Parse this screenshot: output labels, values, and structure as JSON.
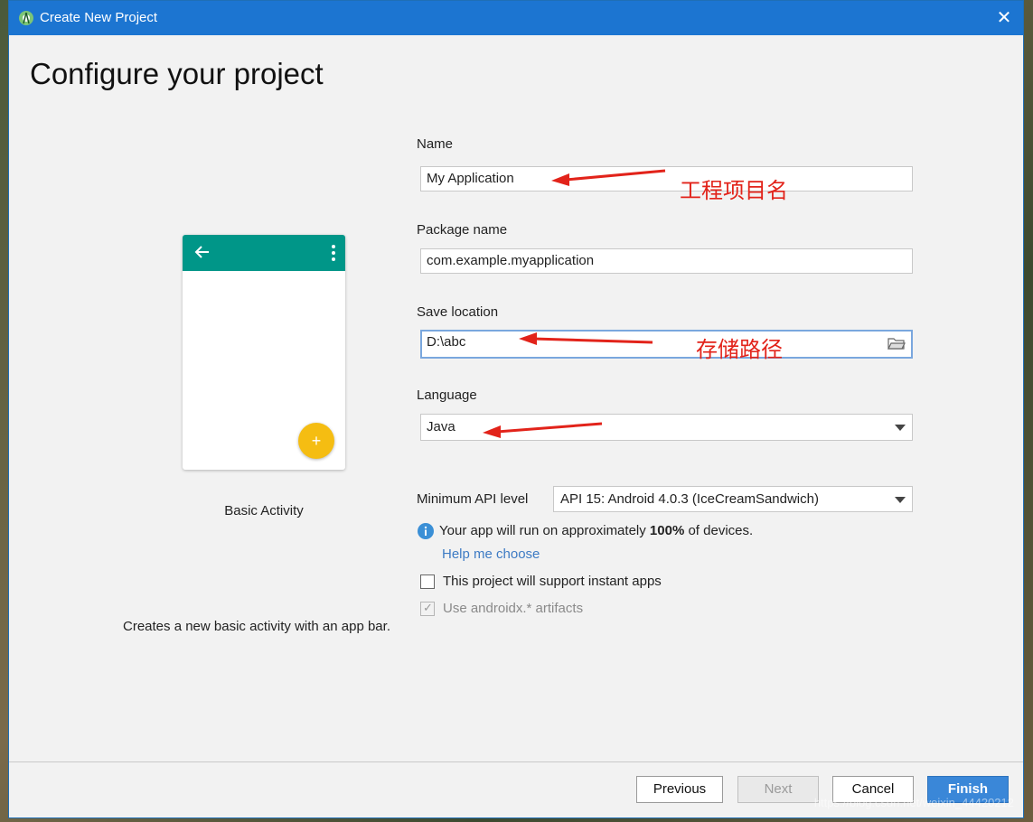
{
  "window": {
    "title": "Create New Project",
    "close_symbol": "✕"
  },
  "page_title": "Configure your project",
  "template": {
    "name": "Basic Activity",
    "description": "Creates a new basic activity with an app bar.",
    "fab_symbol": "+"
  },
  "form": {
    "name": {
      "label": "Name",
      "value": "My Application"
    },
    "package": {
      "label": "Package name",
      "value": "com.example.myapplication"
    },
    "save_location": {
      "label": "Save location",
      "value": "D:\\abc"
    },
    "language": {
      "label": "Language",
      "value": "Java"
    },
    "min_api": {
      "label": "Minimum API level",
      "value": "API 15: Android 4.0.3 (IceCreamSandwich)"
    },
    "info": {
      "prefix": "Your app will run on approximately ",
      "percent": "100%",
      "suffix": " of devices."
    },
    "help_link": "Help me choose",
    "instant_apps": {
      "label": "This project will support instant apps",
      "checked": false
    },
    "androidx": {
      "label": "Use androidx.* artifacts",
      "checked": true,
      "checkmark": "✓",
      "enabled": false
    }
  },
  "annotations": {
    "name_note": "工程项目名",
    "location_note": "存储路径",
    "color": "#e2231a"
  },
  "buttons": {
    "previous": "Previous",
    "next": "Next",
    "cancel": "Cancel",
    "finish": "Finish"
  },
  "watermark": "https://blog.csdn.net/weixin_44420212",
  "colors": {
    "titlebar": "#1c75d1",
    "app_bar": "#009688",
    "fab": "#f5bd12",
    "link": "#3e7bc4",
    "primary_button": "#3a87d8"
  }
}
